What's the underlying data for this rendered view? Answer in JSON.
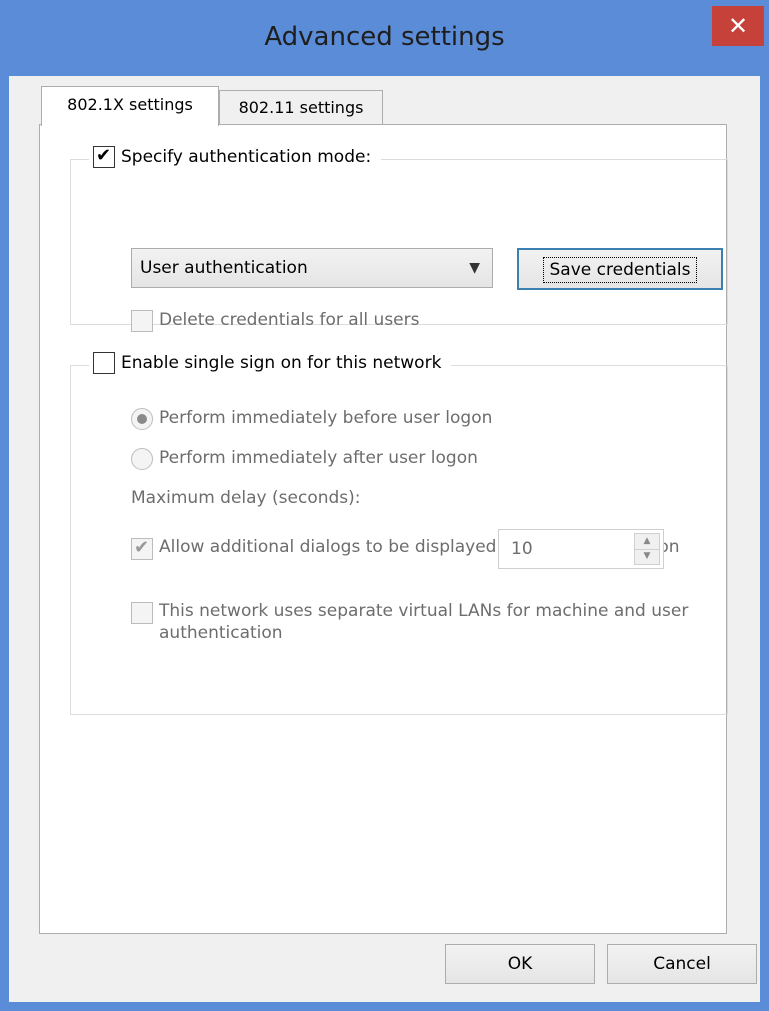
{
  "window": {
    "title": "Advanced settings",
    "close_glyph": "✕"
  },
  "tabs": [
    {
      "label": "802.1X settings",
      "selected": true
    },
    {
      "label": "802.11 settings",
      "selected": false
    }
  ],
  "auth_group": {
    "specify_label": "Specify authentication mode:",
    "specify_checked": true,
    "mode_selected": "User authentication",
    "save_credentials_label": "Save credentials",
    "delete_credentials_label": "Delete credentials for all users",
    "delete_credentials_checked": false
  },
  "sso_group": {
    "enable_label": "Enable single sign on for this network",
    "enable_checked": false,
    "before_logon_label": "Perform immediately before user logon",
    "after_logon_label": "Perform immediately after user logon",
    "max_delay_label": "Maximum delay (seconds):",
    "max_delay_value": "10",
    "allow_dialogs_label": "Allow additional dialogs to be displayed during single sign on",
    "allow_dialogs_checked": true,
    "separate_vlans_label": "This network uses separate virtual LANs for machine and user authentication",
    "separate_vlans_checked": false
  },
  "footer": {
    "ok_label": "OK",
    "cancel_label": "Cancel"
  },
  "colors": {
    "titlebar": "#5b8cd7",
    "close": "#c7413b",
    "focus": "#3c7fb1"
  }
}
